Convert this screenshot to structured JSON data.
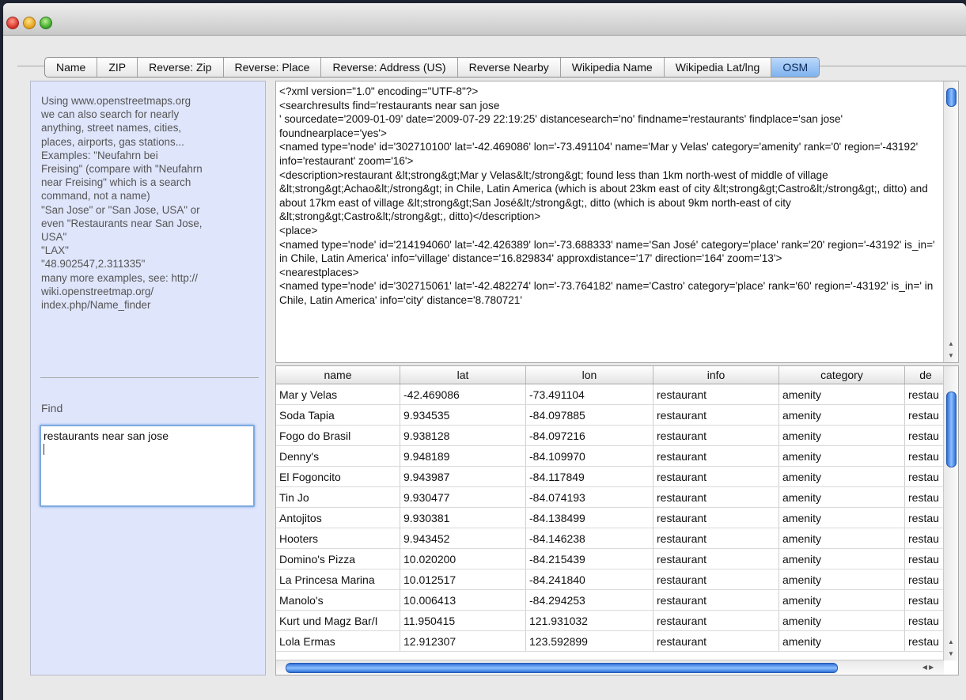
{
  "tabs": [
    "Name",
    "ZIP",
    "Reverse: Zip",
    "Reverse: Place",
    "Reverse: Address (US)",
    "Reverse Nearby",
    "Wikipedia Name",
    "Wikipedia Lat/lng",
    "OSM"
  ],
  "active_tab": "OSM",
  "help_text": "Using www.openstreetmaps.org\nwe can also search for nearly\nanything, street names, cities,\nplaces, airports, gas stations...\nExamples: \"Neufahrn bei\nFreising\" (compare with \"Neufahrn\nnear Freising\" which is a search\ncommand, not a name)\n\"San Jose\" or \"San Jose, USA\" or\neven \"Restaurants near San Jose,\nUSA\"\n\"LAX\"\n\"48.902547,2.311335\"\nmany more examples, see: http://\nwiki.openstreetmap.org/\nindex.php/Name_finder",
  "find_label": "Find",
  "find_value": "restaurants near san jose",
  "xml_text": "<?xml version=\"1.0\" encoding=\"UTF-8\"?>\n<searchresults find='restaurants near san jose\n' sourcedate='2009-01-09' date='2009-07-29 22:19:25' distancesearch='no' findname='restaurants' findplace='san jose' foundnearplace='yes'>\n<named type='node' id='302710100' lat='-42.469086' lon='-73.491104' name='Mar y Velas' category='amenity' rank='0' region='-43192' info='restaurant' zoom='16'>\n<description>restaurant &lt;strong&gt;Mar y Velas&lt;/strong&gt; found less than 1km north-west of middle of village &lt;strong&gt;Achao&lt;/strong&gt; in Chile, Latin America (which is about 23km east of city &lt;strong&gt;Castro&lt;/strong&gt;, ditto) and about 17km east of village &lt;strong&gt;San José&lt;/strong&gt;, ditto (which is about 9km north-east of city &lt;strong&gt;Castro&lt;/strong&gt;, ditto)</description>\n<place>\n<named type='node' id='214194060' lat='-42.426389' lon='-73.688333' name='San José' category='place' rank='20' region='-43192' is_in=' in Chile, Latin America' info='village' distance='16.829834' approxdistance='17' direction='164' zoom='13'>\n<nearestplaces>\n<named type='node' id='302715061' lat='-42.482274' lon='-73.764182' name='Castro' category='place' rank='60' region='-43192' is_in=' in Chile, Latin America' info='city' distance='8.780721'",
  "columns": [
    "name",
    "lat",
    "lon",
    "info",
    "category",
    "de"
  ],
  "rows": [
    [
      "Mar y Velas",
      "-42.469086",
      "-73.491104",
      "restaurant",
      "amenity",
      "restau"
    ],
    [
      "Soda Tapia",
      "9.934535",
      "-84.097885",
      "restaurant",
      "amenity",
      "restau"
    ],
    [
      "Fogo do Brasil",
      "9.938128",
      "-84.097216",
      "restaurant",
      "amenity",
      "restau"
    ],
    [
      "Denny's",
      "9.948189",
      "-84.109970",
      "restaurant",
      "amenity",
      "restau"
    ],
    [
      "El Fogoncito",
      "9.943987",
      "-84.117849",
      "restaurant",
      "amenity",
      "restau"
    ],
    [
      "Tin Jo",
      "9.930477",
      "-84.074193",
      "restaurant",
      "amenity",
      "restau"
    ],
    [
      "Antojitos",
      "9.930381",
      "-84.138499",
      "restaurant",
      "amenity",
      "restau"
    ],
    [
      "Hooters",
      "9.943452",
      "-84.146238",
      "restaurant",
      "amenity",
      "restau"
    ],
    [
      "Domino's Pizza",
      "10.020200",
      "-84.215439",
      "restaurant",
      "amenity",
      "restau"
    ],
    [
      "La Princesa Marina",
      "10.012517",
      "-84.241840",
      "restaurant",
      "amenity",
      "restau"
    ],
    [
      "Manolo's",
      "10.006413",
      "-84.294253",
      "restaurant",
      "amenity",
      "restau"
    ],
    [
      "Kurt und Magz Bar/I",
      "11.950415",
      "121.931032",
      "restaurant",
      "amenity",
      "restau"
    ],
    [
      "Lola Ermas",
      "12.912307",
      "123.592899",
      "restaurant",
      "amenity",
      "restau"
    ]
  ]
}
